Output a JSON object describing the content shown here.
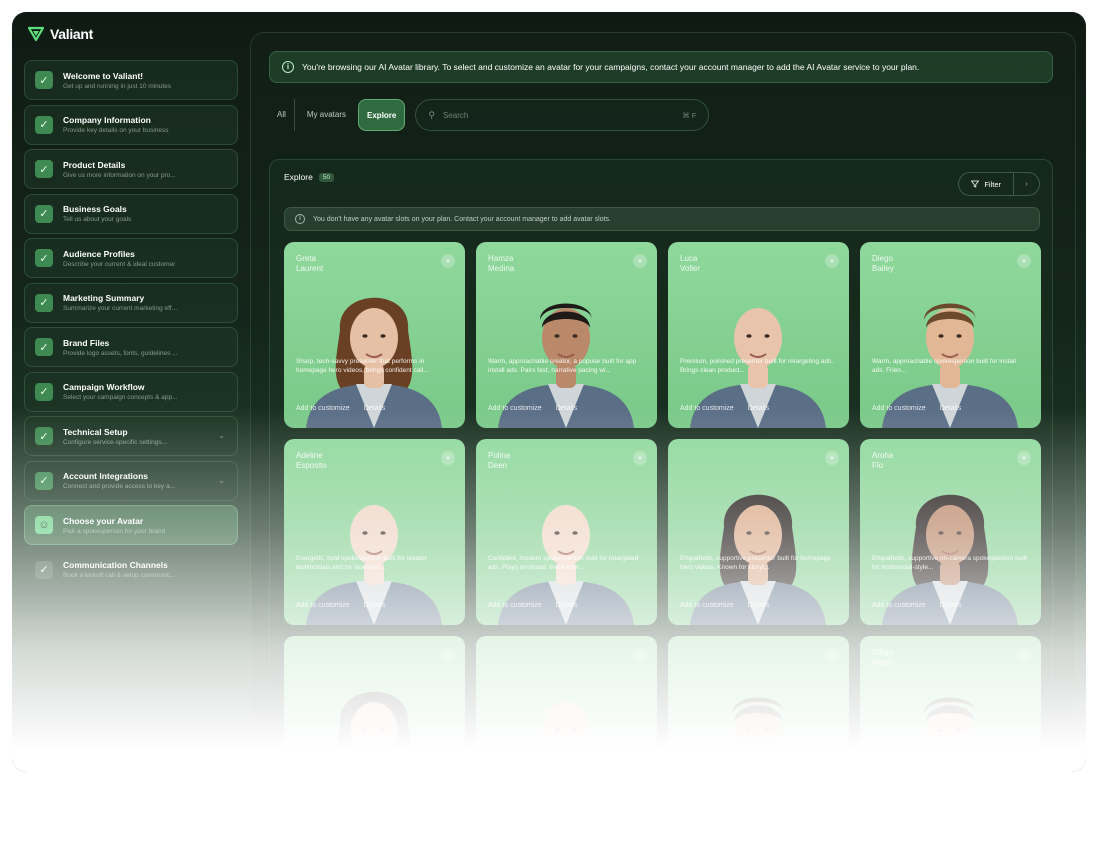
{
  "brand": {
    "name": "Valiant"
  },
  "colors": {
    "accent": "#3f8a52",
    "card_green": "#8fd89c"
  },
  "sidebar": {
    "steps": [
      {
        "title": "Welcome to Valiant!",
        "sub": "Get up and running in just 10 minutes",
        "state": "done"
      },
      {
        "title": "Company Information",
        "sub": "Provide key details on your business",
        "state": "done"
      },
      {
        "title": "Product Details",
        "sub": "Give us more information on your pro...",
        "state": "done"
      },
      {
        "title": "Business Goals",
        "sub": "Tell us about your goals",
        "state": "done"
      },
      {
        "title": "Audience Profiles",
        "sub": "Describe your current & ideal customer",
        "state": "done"
      },
      {
        "title": "Marketing Summary",
        "sub": "Summarize your current marketing eff...",
        "state": "done"
      },
      {
        "title": "Brand Files",
        "sub": "Provide logo assets, fonts, guidelines ...",
        "state": "done"
      },
      {
        "title": "Campaign Workflow",
        "sub": "Select your campaign concepts & app...",
        "state": "done"
      },
      {
        "title": "Technical Setup",
        "sub": "Configure service-specific settings...",
        "state": "done"
      },
      {
        "title": "Account Integrations",
        "sub": "Connect and provide access to key a...",
        "state": "done"
      },
      {
        "title": "Choose your Avatar",
        "sub": "Pick a spokesperson for your brand",
        "state": "active"
      },
      {
        "title": "Communication Channels",
        "sub": "Book a kickoff call & setup communic...",
        "state": "pending"
      }
    ]
  },
  "main": {
    "info": "You're browsing our AI Avatar library. To select and customize an avatar for your campaigns, contact your account manager to add the AI Avatar service to your plan.",
    "tabs": [
      "All",
      "My avatars",
      "Explore"
    ],
    "search": {
      "placeholder": "Search",
      "shortcut": "⌘ F"
    },
    "panel": {
      "title": "Explore",
      "count": "50",
      "filter_label": "Filter",
      "notice": "You don't have any avatar slots on your plan. Contact your account manager to add avatar slots."
    },
    "cards": [
      {
        "first": "Greta",
        "last": "Laurent",
        "desc": "Sharp, tech-savvy presenter that performs in homepage hero videos, brings confident call...",
        "add": "Add to customize",
        "details": "Details"
      },
      {
        "first": "Hamza",
        "last": "Medina",
        "desc": "Warm, approachable creator, a popular built for app install ads. Pairs fast, narrative pacing wi...",
        "add": "Add to customize",
        "details": "Details"
      },
      {
        "first": "Luca",
        "last": "Voller",
        "desc": "Premium, polished presenter built for retargeting ads. Brings clean product...",
        "add": "Add to customize",
        "details": "Details"
      },
      {
        "first": "Diego",
        "last": "Bailey",
        "desc": "Warm, approachable spokesperson built for install ads. Frien...",
        "add": "Add to customize",
        "details": "Details"
      },
      {
        "first": "Adeline",
        "last": "Esposito",
        "desc": "Energetic, bold spokesperson built for creator testimonials and for launches...",
        "add": "Add to customize",
        "details": "Details"
      },
      {
        "first": "Polina",
        "last": "Deen",
        "desc": "Confident, modern spokesperson built for retargeted ads. Plays on-brand, trend-forw...",
        "add": "Add to customize",
        "details": "Details"
      },
      {
        "first": "",
        "last": "",
        "desc": "Empathetic, supportive presenter built for homepage hero videos. Known for storyt...",
        "add": "Add to customize",
        "details": "Details"
      },
      {
        "first": "Aroha",
        "last": "Flo",
        "desc": "Empathetic, supportive on-camera spokesperson built for testimonial-style...",
        "add": "Add to customize",
        "details": "Details"
      },
      {
        "first": "",
        "last": "",
        "desc": "",
        "add": "",
        "details": ""
      },
      {
        "first": "",
        "last": "",
        "desc": "",
        "add": "",
        "details": ""
      },
      {
        "first": "",
        "last": "",
        "desc": "",
        "add": "",
        "details": ""
      },
      {
        "first": "Ethan",
        "last": "Walsh",
        "desc": "",
        "add": "",
        "details": ""
      }
    ]
  }
}
